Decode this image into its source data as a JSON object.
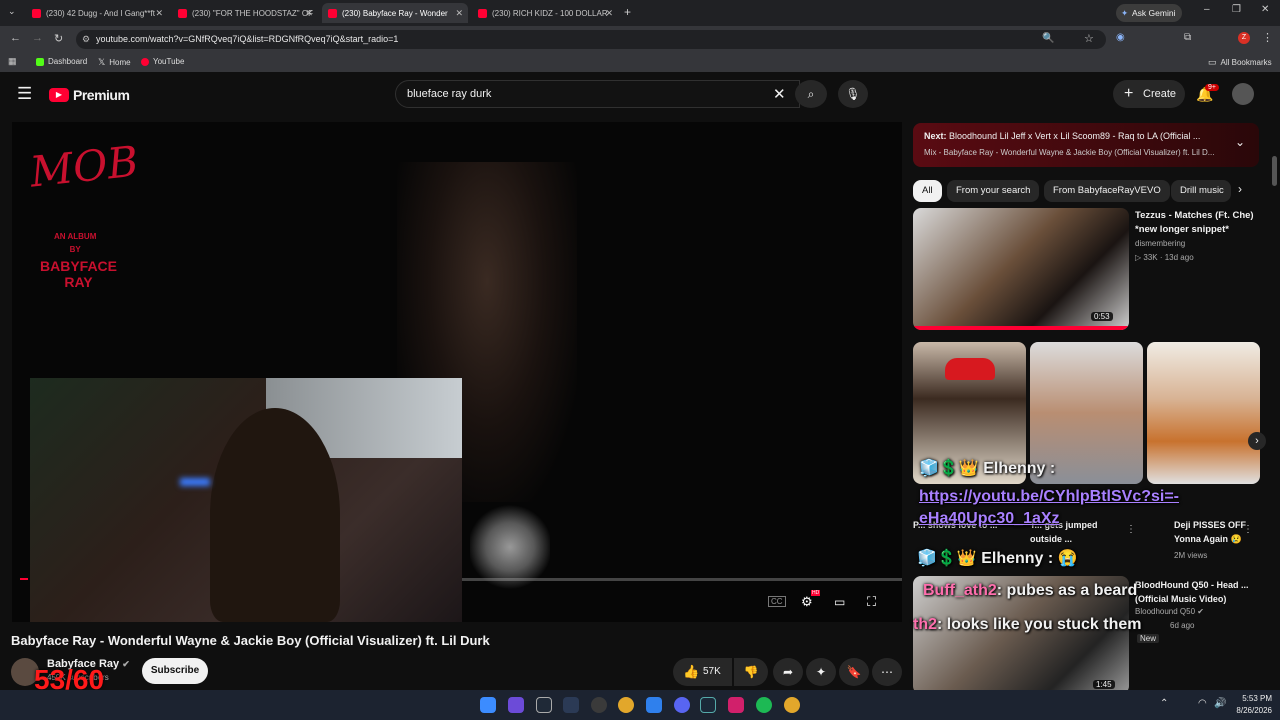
{
  "tabs": [
    {
      "label": "(230) 42 Dugg - And I Gang**ft"
    },
    {
      "label": "(230) \"FOR THE HOODSTAZ\" OF"
    },
    {
      "label": "(230) Babyface Ray - Wonder"
    },
    {
      "label": "(230) RICH KIDZ - 100 DOLLAR"
    }
  ],
  "gemini_label": "Ask Gemini",
  "url": "youtube.com/watch?v=GNfRQveq7iQ&list=RDGNfRQveq7iQ&start_radio=1",
  "bookmarks": {
    "dashboard": "Dashboard",
    "home": "Home",
    "youtube": "YouTube",
    "all": "All Bookmarks"
  },
  "header": {
    "logo": "Premium",
    "search_value": "blueface ray durk",
    "create": "Create",
    "notif_count": "9+"
  },
  "player": {
    "album_title": "MOB",
    "album_sub": "AN ALBUM\nBY",
    "album_artist": "BABYFACE\nRAY",
    "hd_badge": "HD"
  },
  "video": {
    "title": "Babyface Ray - Wonderful Wayne & Jackie Boy (Official Visualizer) ft. Lil Durk",
    "channel": "Babyface Ray",
    "subs": "459K subscribers",
    "subscribe": "Subscribe",
    "likes": "57K",
    "counter": "53/60"
  },
  "next_card": {
    "label": "Next:",
    "title": "Bloodhound Lil Jeff x Vert x Lil Scoom89 - Raq to LA (Official ...",
    "mix": "Mix - Babyface Ray - Wonderful Wayne & Jackie Boy (Official Visualizer) ft. Lil D..."
  },
  "chips": [
    "All",
    "From your search",
    "From BabyfaceRayVEVO",
    "Drill music"
  ],
  "rec1": {
    "title": "Tezzus - Matches (Ft. Che) *new longer snippet*",
    "channel": "dismembering",
    "views": "33K",
    "age": "13d ago",
    "duration": "0:53"
  },
  "shorts": [
    {
      "title": "P... shows love to ..."
    },
    {
      "title": "T... gets jumped outside ..."
    },
    {
      "title": "Deji PISSES OFF Yonna Again 😢",
      "views": "2M views"
    }
  ],
  "rec2": {
    "title": "BloodHound Q50 - Head ... (Official Music Video)",
    "channel": "Bloodhound Q50",
    "age": "6d ago",
    "badge": "New",
    "duration": "1:45"
  },
  "chat": [
    {
      "user": "Elhenny :",
      "text": ""
    },
    {
      "user": "",
      "text": "https://youtu.be/CYhlpBtlSVc?si=-eHa40Upc30_1aXz"
    },
    {
      "user": "Elhenny :",
      "text": "😭"
    },
    {
      "user": "Buff_ath2",
      "text": ": pubes as a beard"
    },
    {
      "user": "th2",
      "text": ": looks like you stuck them"
    }
  ],
  "taskbar": {
    "time": "5:53 PM",
    "date": "8/26/2026"
  },
  "colors": {
    "accent": "#ff0033",
    "chat_user": "#ff6fae",
    "link": "#a980ff"
  }
}
